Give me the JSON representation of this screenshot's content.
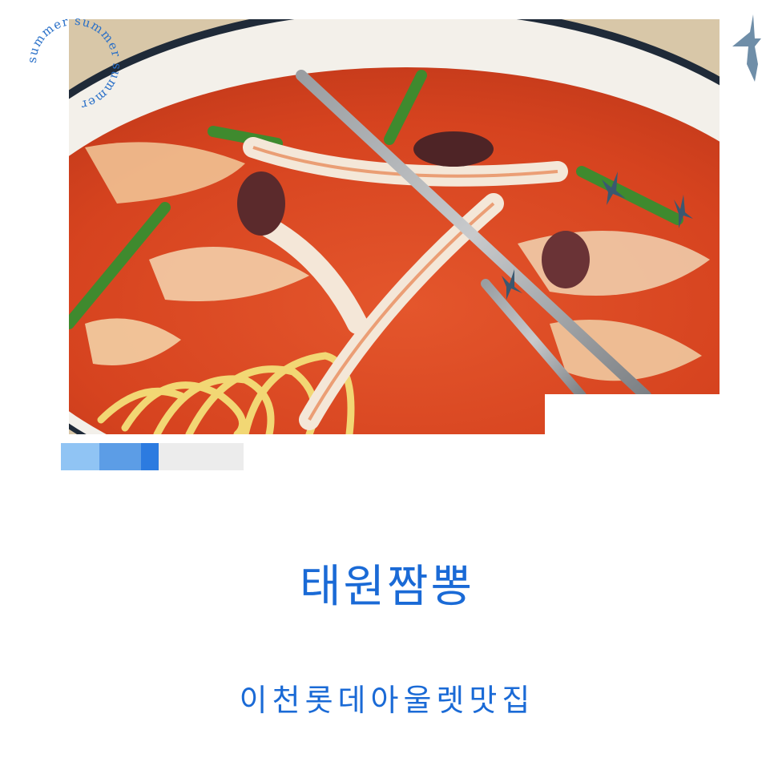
{
  "title": "태원짬뽕",
  "subtitle": "이천롯데아울렛맛집",
  "stamp_text": "summer summer summer",
  "photo": {
    "icon": "jjamppong-photo"
  },
  "colors": {
    "accent": "#1a6ad6",
    "stripe_light": "#90c4f4",
    "stripe_mid": "#5c9de6",
    "stripe_dark": "#2c7be0",
    "stripe_gray": "#ececec"
  }
}
